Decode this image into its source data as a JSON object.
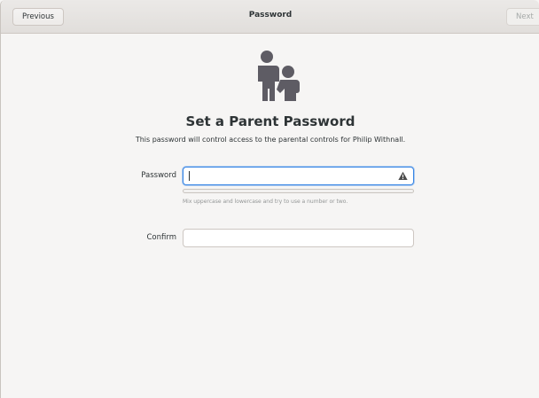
{
  "header": {
    "title": "Password",
    "previous_label": "Previous",
    "next_label": "Next"
  },
  "page": {
    "heading": "Set a Parent Password",
    "subtitle": "This password will control access to the parental controls for Philip Withnall.",
    "illustration_icon": "parent-child-icon"
  },
  "form": {
    "password_label": "Password",
    "password_value": "",
    "password_warning_icon": "warning-icon",
    "strength_level": 0,
    "hint": "Mix uppercase and lowercase and try to use a number or two.",
    "confirm_label": "Confirm",
    "confirm_value": ""
  },
  "colors": {
    "accent": "#3584e4",
    "icon_gray": "#5e5c64",
    "background": "#f6f5f4"
  }
}
